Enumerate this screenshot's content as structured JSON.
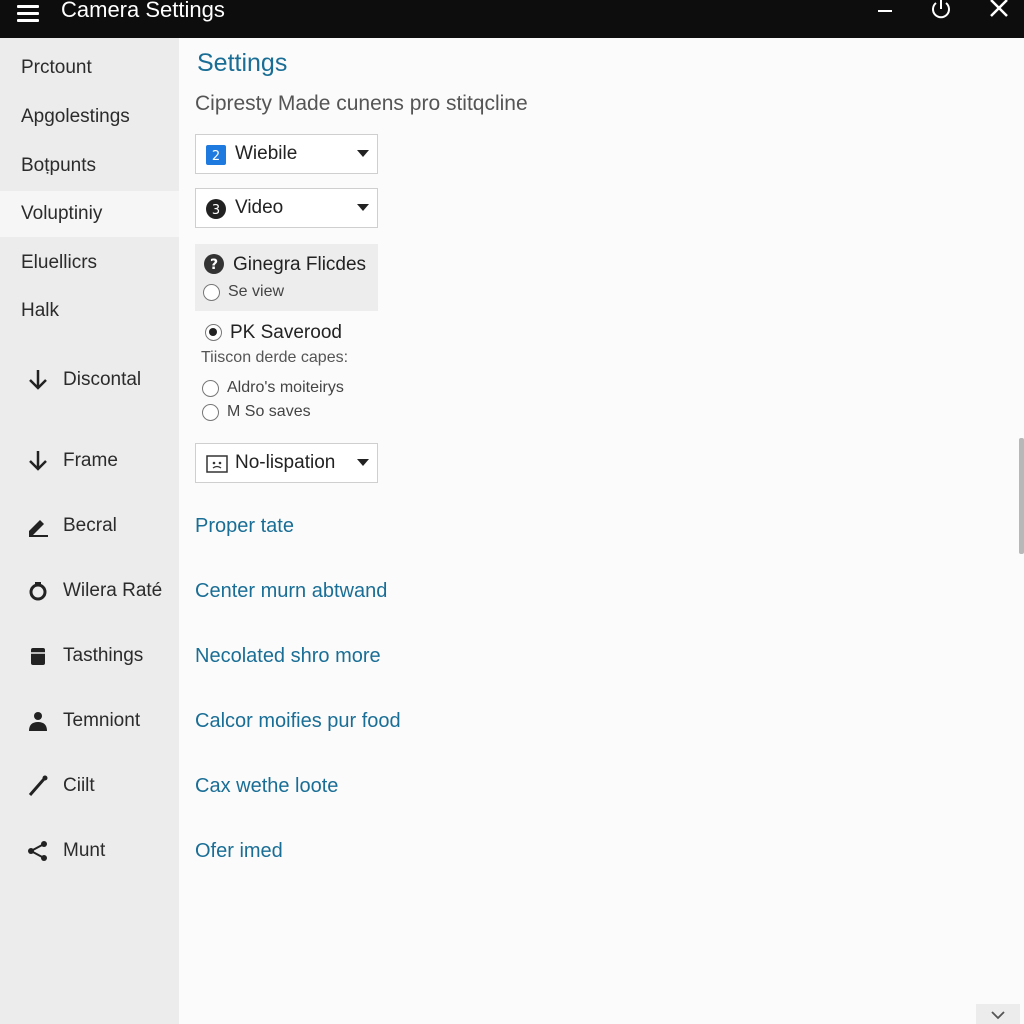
{
  "window": {
    "title": "Camera Settings",
    "icons": {
      "menu": "hamburger-menu-icon",
      "minimize": "minimize-icon",
      "power": "power-icon",
      "close": "close-icon"
    }
  },
  "sidebar": {
    "items": [
      {
        "label": "Prctount"
      },
      {
        "label": "Apgolestings"
      },
      {
        "label": "Boṭpunts"
      },
      {
        "label": "Voluptiniy",
        "selected": true
      },
      {
        "label": "Eluellicrs"
      },
      {
        "label": "Halk"
      },
      {
        "label": "Discontal",
        "icon": "arrow-down-icon"
      },
      {
        "label": "Frame",
        "icon": "arrow-down-icon"
      },
      {
        "label": "Becral",
        "icon": "pen-icon"
      },
      {
        "label": "Wilera Raté",
        "icon": "camera-ring-icon"
      },
      {
        "label": "Tasthings",
        "icon": "storage-icon"
      },
      {
        "label": "Temniont",
        "icon": "person-icon"
      },
      {
        "label": "Ciilt",
        "icon": "pencil-icon"
      },
      {
        "label": "Munt",
        "icon": "share-icon"
      }
    ]
  },
  "main": {
    "title": "Settings",
    "description": "Cipresty Made cunens pro stitqcline",
    "dropdowns": [
      {
        "value": "Wiebile",
        "icon": "numbered-badge-icon",
        "badge": "2"
      },
      {
        "value": "Video",
        "icon": "numbered-circle-icon",
        "badge": "3"
      }
    ],
    "group": {
      "title": "Ginegra Flicdes",
      "icon": "help-icon",
      "option": "Se view"
    },
    "primary_option": {
      "label": "PK Saverood",
      "checked": true
    },
    "caption": "Tiiscon derde capes:",
    "options": [
      {
        "label": "Aldro's moiteirys",
        "checked": false
      },
      {
        "label": "M So saves",
        "checked": false
      }
    ],
    "mode_dropdown": {
      "value": "No-lispation",
      "icon": "frame-icon"
    },
    "links": [
      "Proper tate",
      "Center murn abtwand",
      "Necolated shro more",
      "Calcor moifies pur food",
      "Cax wethe loote",
      "Ofer imed"
    ]
  },
  "colors": {
    "titlebar": "#0d0d0d",
    "accent": "#1a6e96",
    "sidebar": "#ececec",
    "badge": "#1f7ae0"
  }
}
